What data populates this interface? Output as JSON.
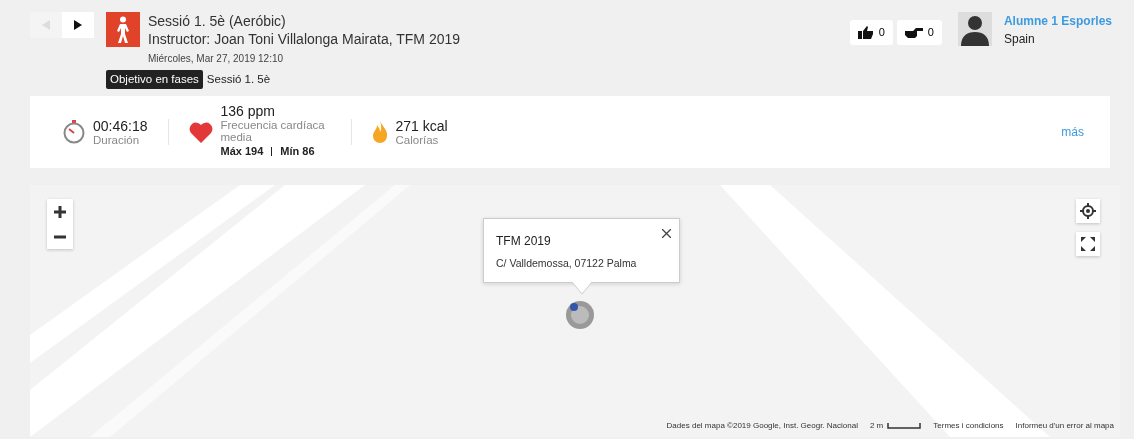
{
  "session": {
    "title": "Sessió 1. 5è (Aeróbic)",
    "instructor": "Instructor: Joan Toni Villalonga Mairata, TFM 2019",
    "date": "Miércoles, Mar 27, 2019 12:10",
    "tag": "Objetivo en fases",
    "tag_text": "Sessió 1. 5è"
  },
  "nav": {
    "prev_disabled": true,
    "next_disabled": false
  },
  "reactions": [
    {
      "kind": "like",
      "count": "0"
    },
    {
      "kind": "point",
      "count": "0"
    }
  ],
  "user": {
    "name": "Alumne 1 Esporles",
    "country": "Spain"
  },
  "stats": [
    {
      "kind": "duration",
      "value": "00:46:18",
      "label": "Duración"
    },
    {
      "kind": "heart",
      "value": "136 ppm",
      "label": "Frecuencia cardíaca media",
      "extra_max": "Máx 194",
      "extra_min": "Mín 86"
    },
    {
      "kind": "calories",
      "value": "271 kcal",
      "label": "Calorías"
    }
  ],
  "more_link": "más",
  "map": {
    "popup": {
      "title": "TFM 2019",
      "address": "C/ Valldemossa, 07122 Palma"
    },
    "footer": [
      "Dades del mapa ©2019 Google, Inst. Geogr. Nacional",
      "2 m",
      "Termes i condicions",
      "Informeu d'un error al mapa"
    ]
  }
}
